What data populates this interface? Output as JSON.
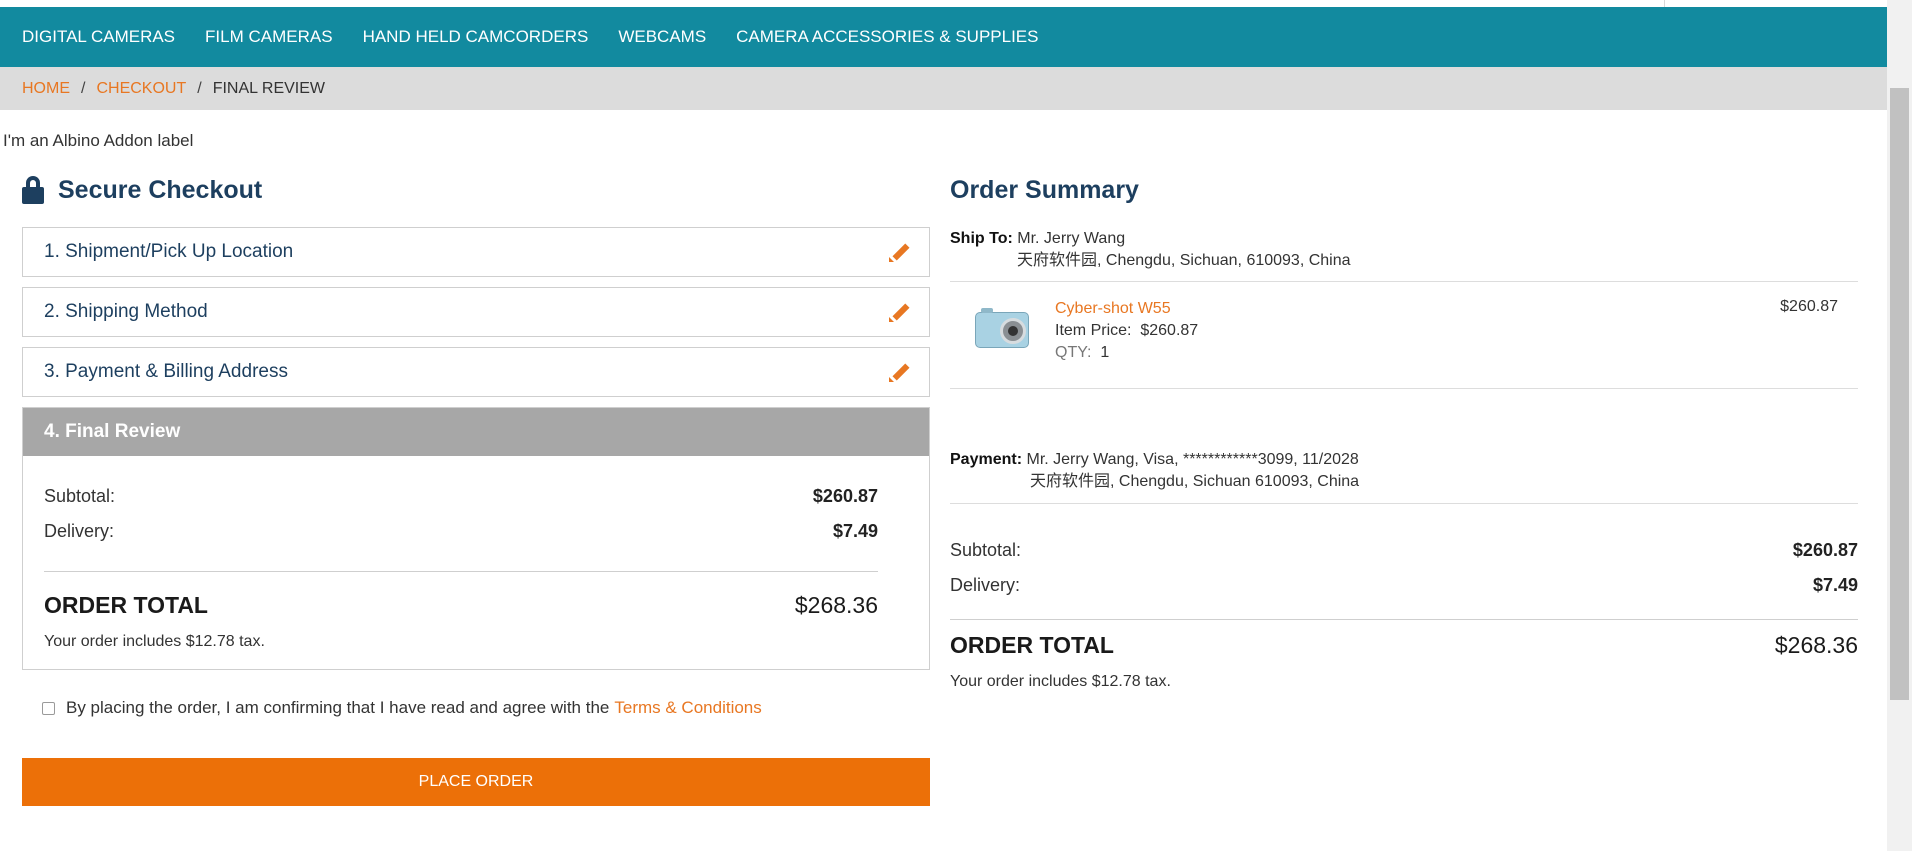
{
  "nav": {
    "items": [
      "DIGITAL CAMERAS",
      "FILM CAMERAS",
      "HAND HELD CAMCORDERS",
      "WEBCAMS",
      "CAMERA ACCESSORIES & SUPPLIES"
    ]
  },
  "breadcrumb": {
    "home": "HOME",
    "checkout": "CHECKOUT",
    "current": "FINAL REVIEW",
    "separator": "/"
  },
  "addon_label": "I'm an Albino Addon label",
  "checkout": {
    "title": "Secure Checkout",
    "steps": [
      {
        "label": "1. Shipment/Pick Up Location"
      },
      {
        "label": "2. Shipping Method"
      },
      {
        "label": "3. Payment & Billing Address"
      }
    ],
    "final_step": {
      "label": "4. Final Review"
    },
    "subtotal_label": "Subtotal:",
    "subtotal_value": "$260.87",
    "delivery_label": "Delivery:",
    "delivery_value": "$7.49",
    "order_total_label": "ORDER TOTAL",
    "order_total_value": "$268.36",
    "tax_note": "Your order includes $12.78 tax.",
    "agree_text": "By placing the order, I am confirming that I have read and agree with the",
    "terms_link": "Terms & Conditions",
    "place_order_label": "PLACE ORDER"
  },
  "summary": {
    "title": "Order Summary",
    "ship_to_label": "Ship To:",
    "ship_to_name": "Mr. Jerry Wang",
    "ship_to_address": "天府软件园,  Chengdu,  Sichuan,  610093,  China",
    "item": {
      "name": "Cyber-shot W55",
      "item_price_label": "Item Price:",
      "item_price_value": "$260.87",
      "qty_label": "QTY:",
      "qty_value": "1",
      "line_total": "$260.87"
    },
    "payment_label": "Payment:",
    "payment_line1": "Mr. Jerry Wang, Visa, ************3099, 11/2028",
    "payment_line2": "天府软件园, Chengdu, Sichuan 610093, China",
    "subtotal_label": "Subtotal:",
    "subtotal_value": "$260.87",
    "delivery_label": "Delivery:",
    "delivery_value": "$7.49",
    "order_total_label": "ORDER TOTAL",
    "order_total_value": "$268.36",
    "tax_note": "Your order includes $12.78 tax."
  },
  "colors": {
    "nav": "#128a9f",
    "accent": "#e87722",
    "button": "#ec7008",
    "heading": "#1d3f5f"
  }
}
